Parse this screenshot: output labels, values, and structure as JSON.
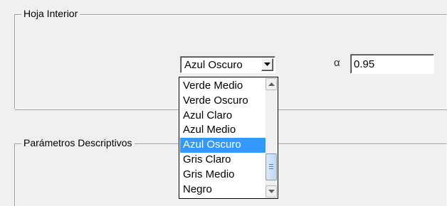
{
  "groups": {
    "inner_sheet_title": "Hoja Interior",
    "descriptive_params_title": "Parámetros Descriptivos"
  },
  "combo": {
    "value": "Azul Oscuro",
    "icon": "chevron-down-icon"
  },
  "alpha": {
    "label": "α",
    "value": "0.95"
  },
  "dropdown": {
    "items": [
      {
        "label": "Verde Medio"
      },
      {
        "label": "Verde Oscuro"
      },
      {
        "label": "Azul Claro"
      },
      {
        "label": "Azul Medio"
      },
      {
        "label": "Azul Oscuro",
        "selected": true
      },
      {
        "label": "Gris Claro"
      },
      {
        "label": "Gris Medio"
      },
      {
        "label": "Negro"
      }
    ],
    "highlight_color": "#3399ff",
    "scroll_position": 0.75
  }
}
